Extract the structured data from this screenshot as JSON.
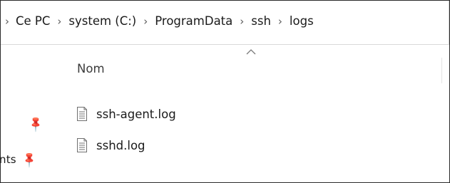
{
  "breadcrumb": {
    "items": [
      "Ce PC",
      "system (C:)",
      "ProgramData",
      "ssh",
      "logs"
    ]
  },
  "navigation": {
    "partial_label": "nts"
  },
  "file_list": {
    "column_name_header": "Nom",
    "sort": "ascending",
    "files": [
      {
        "name": "ssh-agent.log",
        "icon": "text-file-icon"
      },
      {
        "name": "sshd.log",
        "icon": "text-file-icon"
      }
    ]
  },
  "colors": {
    "border": "#2b2b2b",
    "text": "#1a1a1a",
    "separator": "#5a5a5a"
  }
}
